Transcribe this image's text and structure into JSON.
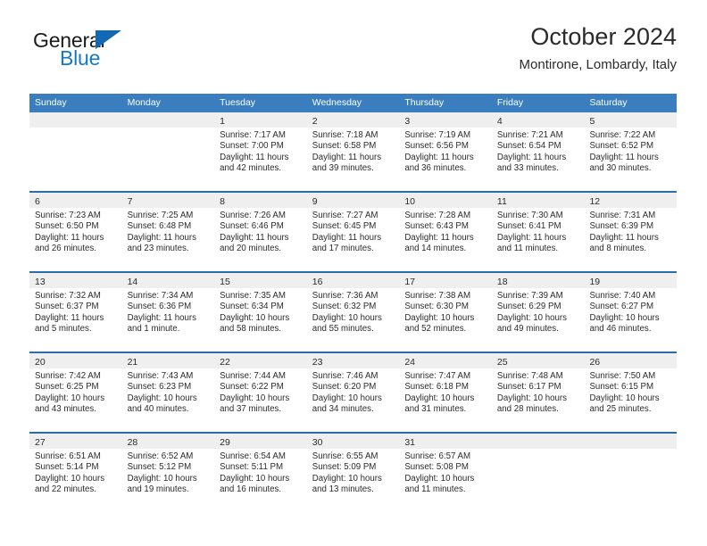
{
  "logo": {
    "word_top": "General",
    "word_bottom": "Blue",
    "triangle_icon": "blue-triangle-icon",
    "color_dark": "#1b1b1b",
    "color_blue": "#1479c6"
  },
  "header": {
    "title": "October 2024",
    "subtitle": "Montirone, Lombardy, Italy"
  },
  "theme": {
    "header_blue": "#3a7ebf",
    "separator_blue": "#2b6cab",
    "daynum_band": "#efefef",
    "text": "#2b2b2b"
  },
  "weekdays": [
    "Sunday",
    "Monday",
    "Tuesday",
    "Wednesday",
    "Thursday",
    "Friday",
    "Saturday"
  ],
  "weeks": [
    [
      {
        "day": "",
        "lines": []
      },
      {
        "day": "",
        "lines": []
      },
      {
        "day": "1",
        "lines": [
          "Sunrise: 7:17 AM",
          "Sunset: 7:00 PM",
          "Daylight: 11 hours",
          "and 42 minutes."
        ]
      },
      {
        "day": "2",
        "lines": [
          "Sunrise: 7:18 AM",
          "Sunset: 6:58 PM",
          "Daylight: 11 hours",
          "and 39 minutes."
        ]
      },
      {
        "day": "3",
        "lines": [
          "Sunrise: 7:19 AM",
          "Sunset: 6:56 PM",
          "Daylight: 11 hours",
          "and 36 minutes."
        ]
      },
      {
        "day": "4",
        "lines": [
          "Sunrise: 7:21 AM",
          "Sunset: 6:54 PM",
          "Daylight: 11 hours",
          "and 33 minutes."
        ]
      },
      {
        "day": "5",
        "lines": [
          "Sunrise: 7:22 AM",
          "Sunset: 6:52 PM",
          "Daylight: 11 hours",
          "and 30 minutes."
        ]
      }
    ],
    [
      {
        "day": "6",
        "lines": [
          "Sunrise: 7:23 AM",
          "Sunset: 6:50 PM",
          "Daylight: 11 hours",
          "and 26 minutes."
        ]
      },
      {
        "day": "7",
        "lines": [
          "Sunrise: 7:25 AM",
          "Sunset: 6:48 PM",
          "Daylight: 11 hours",
          "and 23 minutes."
        ]
      },
      {
        "day": "8",
        "lines": [
          "Sunrise: 7:26 AM",
          "Sunset: 6:46 PM",
          "Daylight: 11 hours",
          "and 20 minutes."
        ]
      },
      {
        "day": "9",
        "lines": [
          "Sunrise: 7:27 AM",
          "Sunset: 6:45 PM",
          "Daylight: 11 hours",
          "and 17 minutes."
        ]
      },
      {
        "day": "10",
        "lines": [
          "Sunrise: 7:28 AM",
          "Sunset: 6:43 PM",
          "Daylight: 11 hours",
          "and 14 minutes."
        ]
      },
      {
        "day": "11",
        "lines": [
          "Sunrise: 7:30 AM",
          "Sunset: 6:41 PM",
          "Daylight: 11 hours",
          "and 11 minutes."
        ]
      },
      {
        "day": "12",
        "lines": [
          "Sunrise: 7:31 AM",
          "Sunset: 6:39 PM",
          "Daylight: 11 hours",
          "and 8 minutes."
        ]
      }
    ],
    [
      {
        "day": "13",
        "lines": [
          "Sunrise: 7:32 AM",
          "Sunset: 6:37 PM",
          "Daylight: 11 hours",
          "and 5 minutes."
        ]
      },
      {
        "day": "14",
        "lines": [
          "Sunrise: 7:34 AM",
          "Sunset: 6:36 PM",
          "Daylight: 11 hours",
          "and 1 minute."
        ]
      },
      {
        "day": "15",
        "lines": [
          "Sunrise: 7:35 AM",
          "Sunset: 6:34 PM",
          "Daylight: 10 hours",
          "and 58 minutes."
        ]
      },
      {
        "day": "16",
        "lines": [
          "Sunrise: 7:36 AM",
          "Sunset: 6:32 PM",
          "Daylight: 10 hours",
          "and 55 minutes."
        ]
      },
      {
        "day": "17",
        "lines": [
          "Sunrise: 7:38 AM",
          "Sunset: 6:30 PM",
          "Daylight: 10 hours",
          "and 52 minutes."
        ]
      },
      {
        "day": "18",
        "lines": [
          "Sunrise: 7:39 AM",
          "Sunset: 6:29 PM",
          "Daylight: 10 hours",
          "and 49 minutes."
        ]
      },
      {
        "day": "19",
        "lines": [
          "Sunrise: 7:40 AM",
          "Sunset: 6:27 PM",
          "Daylight: 10 hours",
          "and 46 minutes."
        ]
      }
    ],
    [
      {
        "day": "20",
        "lines": [
          "Sunrise: 7:42 AM",
          "Sunset: 6:25 PM",
          "Daylight: 10 hours",
          "and 43 minutes."
        ]
      },
      {
        "day": "21",
        "lines": [
          "Sunrise: 7:43 AM",
          "Sunset: 6:23 PM",
          "Daylight: 10 hours",
          "and 40 minutes."
        ]
      },
      {
        "day": "22",
        "lines": [
          "Sunrise: 7:44 AM",
          "Sunset: 6:22 PM",
          "Daylight: 10 hours",
          "and 37 minutes."
        ]
      },
      {
        "day": "23",
        "lines": [
          "Sunrise: 7:46 AM",
          "Sunset: 6:20 PM",
          "Daylight: 10 hours",
          "and 34 minutes."
        ]
      },
      {
        "day": "24",
        "lines": [
          "Sunrise: 7:47 AM",
          "Sunset: 6:18 PM",
          "Daylight: 10 hours",
          "and 31 minutes."
        ]
      },
      {
        "day": "25",
        "lines": [
          "Sunrise: 7:48 AM",
          "Sunset: 6:17 PM",
          "Daylight: 10 hours",
          "and 28 minutes."
        ]
      },
      {
        "day": "26",
        "lines": [
          "Sunrise: 7:50 AM",
          "Sunset: 6:15 PM",
          "Daylight: 10 hours",
          "and 25 minutes."
        ]
      }
    ],
    [
      {
        "day": "27",
        "lines": [
          "Sunrise: 6:51 AM",
          "Sunset: 5:14 PM",
          "Daylight: 10 hours",
          "and 22 minutes."
        ]
      },
      {
        "day": "28",
        "lines": [
          "Sunrise: 6:52 AM",
          "Sunset: 5:12 PM",
          "Daylight: 10 hours",
          "and 19 minutes."
        ]
      },
      {
        "day": "29",
        "lines": [
          "Sunrise: 6:54 AM",
          "Sunset: 5:11 PM",
          "Daylight: 10 hours",
          "and 16 minutes."
        ]
      },
      {
        "day": "30",
        "lines": [
          "Sunrise: 6:55 AM",
          "Sunset: 5:09 PM",
          "Daylight: 10 hours",
          "and 13 minutes."
        ]
      },
      {
        "day": "31",
        "lines": [
          "Sunrise: 6:57 AM",
          "Sunset: 5:08 PM",
          "Daylight: 10 hours",
          "and 11 minutes."
        ]
      },
      {
        "day": "",
        "lines": []
      },
      {
        "day": "",
        "lines": []
      }
    ]
  ]
}
